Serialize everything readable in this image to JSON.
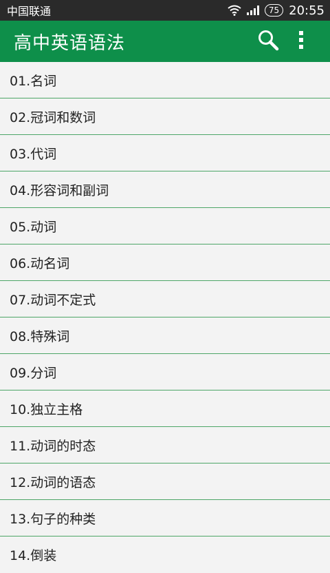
{
  "status_bar": {
    "carrier": "中国联通",
    "battery": "75",
    "time": "20:55"
  },
  "app_bar": {
    "title": "高中英语语法",
    "search_icon": "search-icon",
    "overflow_icon": "more-vert-icon"
  },
  "colors": {
    "app_bar": "#0e8f4a",
    "divider": "#4ca566",
    "status_bar": "#2a2a2a",
    "list_background": "#f3f3f3"
  },
  "list": {
    "items": [
      {
        "label": "01.名词"
      },
      {
        "label": "02.冠词和数词"
      },
      {
        "label": "03.代词"
      },
      {
        "label": "04.形容词和副词"
      },
      {
        "label": "05.动词"
      },
      {
        "label": "06.动名词"
      },
      {
        "label": "07.动词不定式"
      },
      {
        "label": "08.特殊词"
      },
      {
        "label": "09.分词"
      },
      {
        "label": "10.独立主格"
      },
      {
        "label": "11.动词的时态"
      },
      {
        "label": "12.动词的语态"
      },
      {
        "label": "13.句子的种类"
      },
      {
        "label": "14.倒装"
      }
    ]
  }
}
